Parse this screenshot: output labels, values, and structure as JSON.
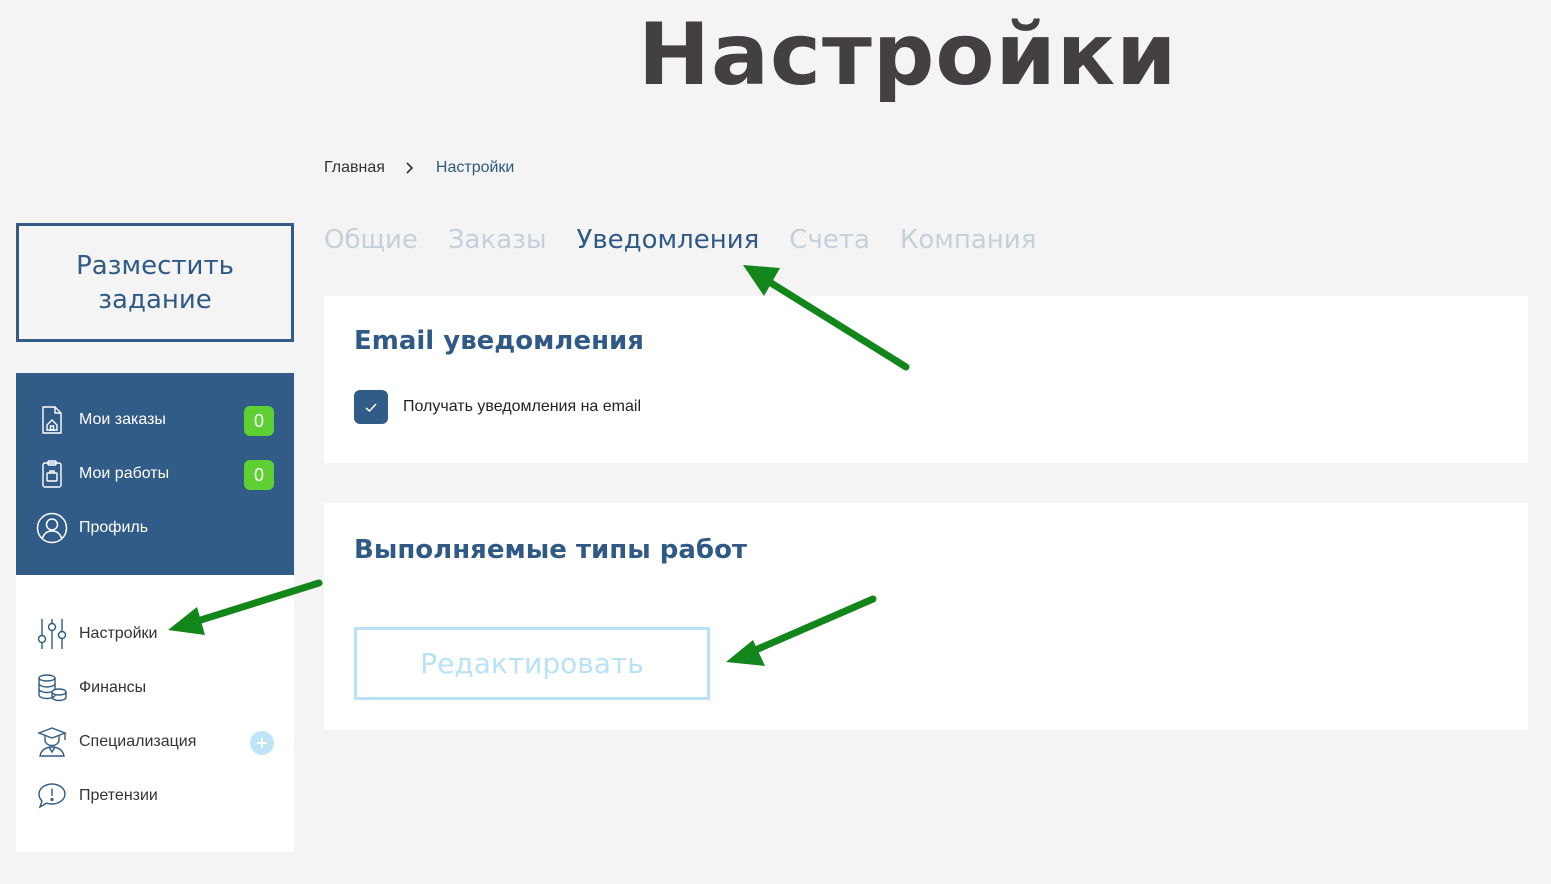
{
  "header": {
    "title": "Настройки"
  },
  "breadcrumb": {
    "home": "Главная",
    "current": "Настройки"
  },
  "tabs": [
    {
      "label": "Общие",
      "active": false
    },
    {
      "label": "Заказы",
      "active": false
    },
    {
      "label": "Уведомления",
      "active": true
    },
    {
      "label": "Счета",
      "active": false
    },
    {
      "label": "Компания",
      "active": false
    }
  ],
  "sidebar": {
    "post_task_label": "Разместить задание",
    "primary_items": [
      {
        "label": "Мои заказы",
        "icon": "orders-document-icon",
        "count": "0"
      },
      {
        "label": "Мои работы",
        "icon": "works-clipboard-icon",
        "count": "0"
      },
      {
        "label": "Профиль",
        "icon": "user-profile-icon"
      }
    ],
    "secondary_items": [
      {
        "label": "Настройки",
        "icon": "sliders-settings-icon"
      },
      {
        "label": "Финансы",
        "icon": "coins-stack-icon"
      },
      {
        "label": "Специализация",
        "icon": "graduate-icon",
        "badge_icon": "plus-icon"
      },
      {
        "label": "Претензии",
        "icon": "exclamation-speech-bubble-icon"
      }
    ]
  },
  "email_notifications": {
    "title": "Email уведомления",
    "checkbox_label": "Получать уведомления на email",
    "checked": true
  },
  "work_types": {
    "title": "Выполняемые типы работ",
    "edit_label": "Редактировать"
  },
  "annotations": {
    "arrow_color": "#12861a"
  },
  "colors": {
    "page_background": "#f4f4f4",
    "title_text": "#433f42",
    "primary_blue": "#325c88",
    "inactive_tab": "#c5d0da",
    "badge_green": "#5fd033",
    "light_blue": "#b9e2f8"
  }
}
